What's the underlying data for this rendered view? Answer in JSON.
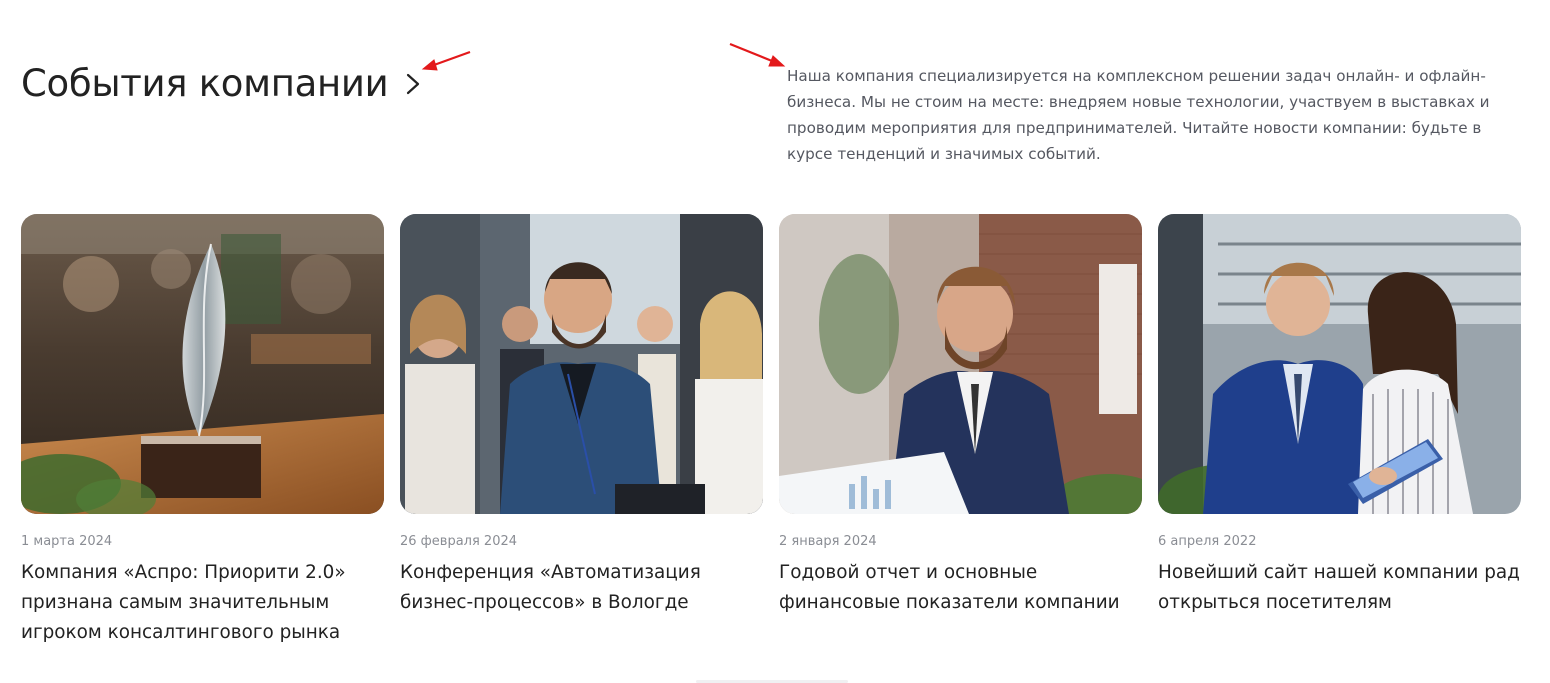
{
  "header": {
    "title": "События компании",
    "link_icon": "chevron-right-icon"
  },
  "description": "Наша компания специализируется на комплексном решении задач онлайн- и офлайн-бизнеса. Мы не стоим на месте: внедряем новые технологии, участвуем в выставках и проводим мероприятия для предпринимателей. Читайте новости компании: будьте в курсе тенденций и значимых событий.",
  "colors": {
    "annotation_arrow": "#e3191b",
    "title_text": "#222222",
    "date_text": "#8a8d94",
    "description_text": "#555861"
  },
  "cards": [
    {
      "date": "1 марта 2024",
      "title": "Компания «Аспро: Приорити 2.0» признана самым значительным игроком консалтингового рынка",
      "image": "award-trophy-photo"
    },
    {
      "date": "26 февраля 2024",
      "title": "Конференция «Автоматизация бизнес-процессов» в Вологде",
      "image": "conference-audience-photo"
    },
    {
      "date": "2 января 2024",
      "title": "Годовой отчет и основные финансовые показатели компании",
      "image": "businessman-report-photo"
    },
    {
      "date": "6 апреля 2022",
      "title": "Новейший сайт нашей компании рад открыться посетителям",
      "image": "colleagues-tablet-photo"
    }
  ]
}
